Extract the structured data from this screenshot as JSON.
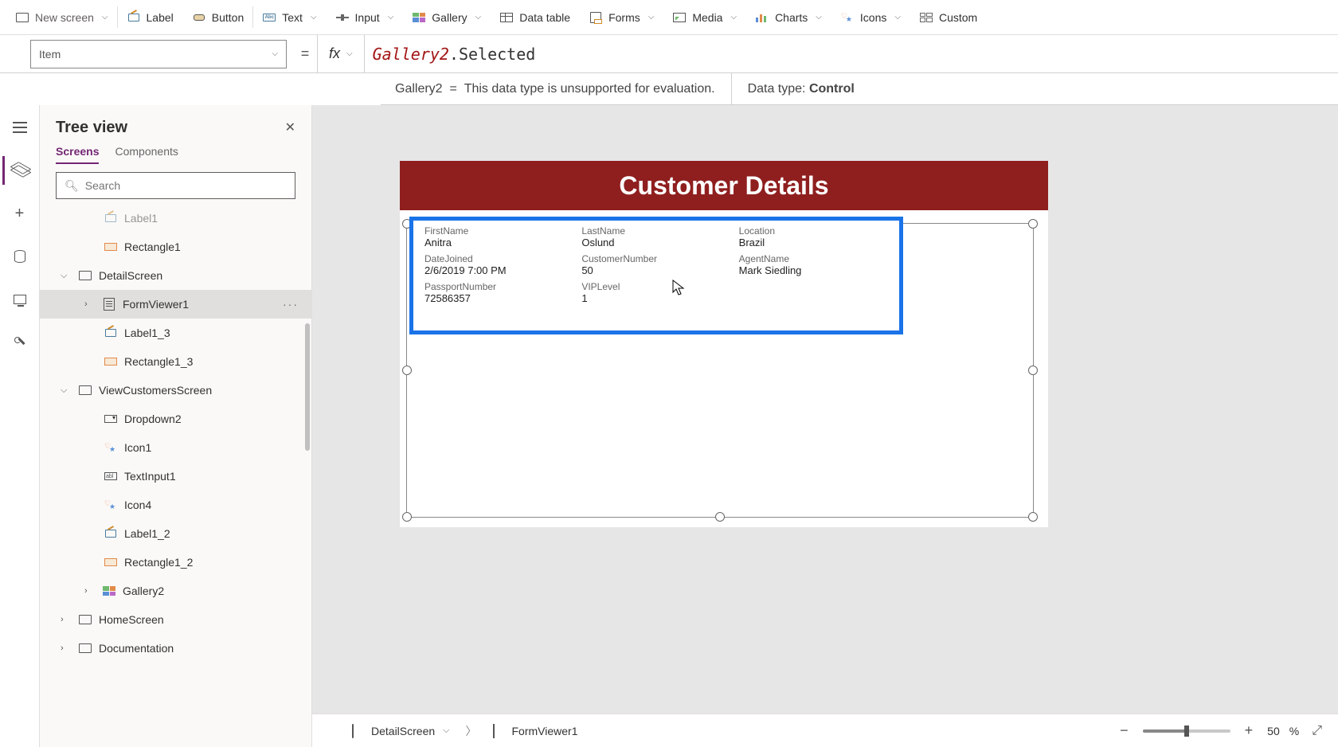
{
  "ribbon": {
    "newScreen": "New screen",
    "label": "Label",
    "button": "Button",
    "text": "Text",
    "input": "Input",
    "gallery": "Gallery",
    "dataTable": "Data table",
    "forms": "Forms",
    "media": "Media",
    "charts": "Charts",
    "icons": "Icons",
    "custom": "Custom"
  },
  "propBar": {
    "property": "Item",
    "fx": "fx",
    "formula_tok1": "Gallery2",
    "formula_tok2": ".Selected"
  },
  "resultBar": {
    "leftName": "Gallery2",
    "leftEq": "=",
    "leftMsg": "This data type is unsupported for evaluation.",
    "rightLabel": "Data type:",
    "rightValue": "Control"
  },
  "treePanel": {
    "title": "Tree view",
    "tabs": {
      "screens": "Screens",
      "components": "Components"
    },
    "searchPlaceholder": "Search"
  },
  "tree": {
    "label1": "Label1",
    "rectangle1": "Rectangle1",
    "detailScreen": "DetailScreen",
    "formViewer1": "FormViewer1",
    "label1_3": "Label1_3",
    "rectangle1_3": "Rectangle1_3",
    "viewCustomersScreen": "ViewCustomersScreen",
    "dropdown2": "Dropdown2",
    "icon1": "Icon1",
    "textInput1": "TextInput1",
    "icon4": "Icon4",
    "label1_2": "Label1_2",
    "rectangle1_2": "Rectangle1_2",
    "gallery2": "Gallery2",
    "homeScreen": "HomeScreen",
    "documentation": "Documentation",
    "ellipsis": "···"
  },
  "screen": {
    "title": "Customer Details",
    "fields": {
      "firstName": {
        "label": "FirstName",
        "value": "Anitra"
      },
      "lastName": {
        "label": "LastName",
        "value": "Oslund"
      },
      "location": {
        "label": "Location",
        "value": "Brazil"
      },
      "dateJoined": {
        "label": "DateJoined",
        "value": "2/6/2019 7:00 PM"
      },
      "customerNumber": {
        "label": "CustomerNumber",
        "value": "50"
      },
      "agentName": {
        "label": "AgentName",
        "value": "Mark Siedling"
      },
      "passportNumber": {
        "label": "PassportNumber",
        "value": "72586357"
      },
      "vipLevel": {
        "label": "VIPLevel",
        "value": "1"
      }
    }
  },
  "footer": {
    "crumb1": "DetailScreen",
    "crumb2": "FormViewer1",
    "zoomValue": "50",
    "zoomPct": "%"
  }
}
